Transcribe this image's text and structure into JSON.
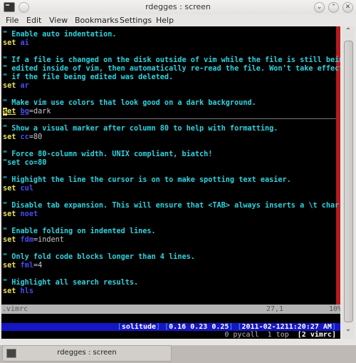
{
  "window": {
    "title": "rdegges : screen",
    "buttons": [
      "minimize",
      "maximize",
      "close"
    ],
    "button_glyphs": {
      "minimize": "⌄",
      "maximize": "⌃",
      "close": "✕"
    }
  },
  "menubar": {
    "items": [
      "File",
      "Edit",
      "View",
      "Bookmarks",
      "Settings",
      "Help"
    ]
  },
  "editor": {
    "lines": [
      {
        "type": "comment",
        "text": "\" Enable auto indentation."
      },
      {
        "type": "set",
        "kw": "set",
        "opt": "ai",
        "val": ""
      },
      {
        "type": "blank"
      },
      {
        "type": "comment",
        "text": "\" If a file is changed on the disk outside of vim while the file is still being"
      },
      {
        "type": "comment",
        "text": "\" edited inside of vim, then automatically re-read the file. Won't take effect"
      },
      {
        "type": "comment",
        "text": "\" if the file being edited was deleted."
      },
      {
        "type": "set",
        "kw": "set",
        "opt": "ar",
        "val": ""
      },
      {
        "type": "blank"
      },
      {
        "type": "comment",
        "text": "\" Make vim use colors that look good on a dark background."
      },
      {
        "type": "cursor",
        "kw": "set",
        "opt": "bg",
        "val": "=dark"
      },
      {
        "type": "blank"
      },
      {
        "type": "comment",
        "text": "\" Show a visual marker after column 80 to help with formatting."
      },
      {
        "type": "set",
        "kw": "set",
        "opt": "cc",
        "val": "=80"
      },
      {
        "type": "blank"
      },
      {
        "type": "comment",
        "text": "\" Force 80-column width. UNIX compliant, biatch!"
      },
      {
        "type": "comment",
        "text": "\"set co=80"
      },
      {
        "type": "blank"
      },
      {
        "type": "comment",
        "text": "\" Highight the line the cursor is on to make spotting text easier."
      },
      {
        "type": "set",
        "kw": "set",
        "opt": "cul",
        "val": ""
      },
      {
        "type": "blank"
      },
      {
        "type": "comment",
        "text": "\" Disable tab expansion. This will ensure that <TAB> always inserts a \\t char."
      },
      {
        "type": "set",
        "kw": "set",
        "opt": "noet",
        "val": ""
      },
      {
        "type": "blank"
      },
      {
        "type": "comment",
        "text": "\" Enable folding on indented lines."
      },
      {
        "type": "set",
        "kw": "set",
        "opt": "fdm",
        "val": "=indent"
      },
      {
        "type": "blank"
      },
      {
        "type": "comment",
        "text": "\" Only fold code blocks longer than 4 lines."
      },
      {
        "type": "set",
        "kw": "set",
        "opt": "fml",
        "val": "=4"
      },
      {
        "type": "blank"
      },
      {
        "type": "comment",
        "text": "\" Highlight all search results."
      },
      {
        "type": "set",
        "kw": "set",
        "opt": "hls",
        "val": ""
      }
    ],
    "status": {
      "filename": ".vimrc",
      "position": "27,1",
      "percent": "10%"
    }
  },
  "screen": {
    "hostname": "solitude",
    "load": "0.16 0.23 0.25",
    "datetime": "2011-02-1211:20:27 AM",
    "windows": "0 pycall  1 top  ",
    "current_window": "[2 vimrc]"
  },
  "colors": {
    "comment": "#2ed3df",
    "keyword": "#e8e35a",
    "option": "#4a4df0",
    "colorcolumn": "#b51b1b",
    "hardstatus_bg": "#1616c4"
  },
  "taskbar": {
    "task_label": "rdegges : screen"
  }
}
